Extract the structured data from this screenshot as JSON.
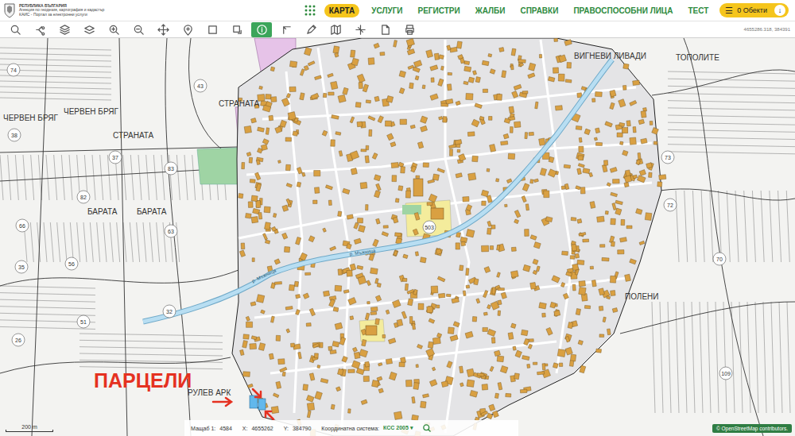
{
  "header": {
    "logo_lines": [
      "РЕПУБЛИКА БЪЛГАРИЯ",
      "Агенция по геодезия, картография и кадастър",
      "КАИС - Портал за електронни услуги"
    ],
    "nav": [
      {
        "label": "КАРТА",
        "selected": true
      },
      {
        "label": "УСЛУГИ",
        "selected": false
      },
      {
        "label": "РЕГИСТРИ",
        "selected": false
      },
      {
        "label": "ЖАЛБИ",
        "selected": false
      },
      {
        "label": "СПРАВКИ",
        "selected": false
      },
      {
        "label": "ПРАВОСПОСОБНИ ЛИЦА",
        "selected": false
      },
      {
        "label": "ТЕСТ",
        "selected": false
      }
    ],
    "objects_button": {
      "menu_icon": "☰",
      "label": "0 Обекти",
      "arrow": "↓"
    }
  },
  "toolbar": {
    "tools": [
      {
        "selected": false
      },
      {
        "selected": false
      },
      {
        "selected": false
      },
      {
        "selected": false
      },
      {
        "selected": false
      },
      {
        "selected": false
      },
      {
        "selected": false
      },
      {
        "selected": false
      },
      {
        "selected": false
      },
      {
        "selected": false
      },
      {
        "selected": true
      },
      {
        "selected": false
      },
      {
        "selected": false
      },
      {
        "selected": false
      },
      {
        "selected": false
      },
      {
        "selected": false
      },
      {
        "selected": false
      }
    ],
    "coordinates": "4655286.318, 384391"
  },
  "map": {
    "places": [
      "СТРАНАТА",
      "СТРАНАТА",
      "ЧЕРВЕН БРЯГ",
      "ЧЕРВЕН БРЯГ",
      "БАРАТА",
      "БАРАТА",
      "ВИГНЕВИ ЛИВАДИ",
      "ТОПОЛИТЕ",
      "ПОЛЕНИ",
      "РУЛЕВ АРК"
    ],
    "numbers": [
      "74",
      "43",
      "38",
      "37",
      "83",
      "82",
      "66",
      "63",
      "35",
      "56",
      "51",
      "32",
      "26",
      "73",
      "72",
      "70",
      "109"
    ],
    "river_labels": [
      "р. Мъжница",
      "р. Мъжница"
    ],
    "block_number": "503",
    "annotation": "ПАРЦЕЛИ",
    "scale": "200 m",
    "attribution": "© OpenStreetMap contributors."
  },
  "status_bar": {
    "scale_label": "Мащаб 1:",
    "scale": "4584",
    "x_label": "X:",
    "x": "4655262",
    "y_label": "Y:",
    "y": "384790",
    "crs_label": "Координатна система:",
    "crs": "КСС 2005",
    "dropdown": "▾"
  }
}
